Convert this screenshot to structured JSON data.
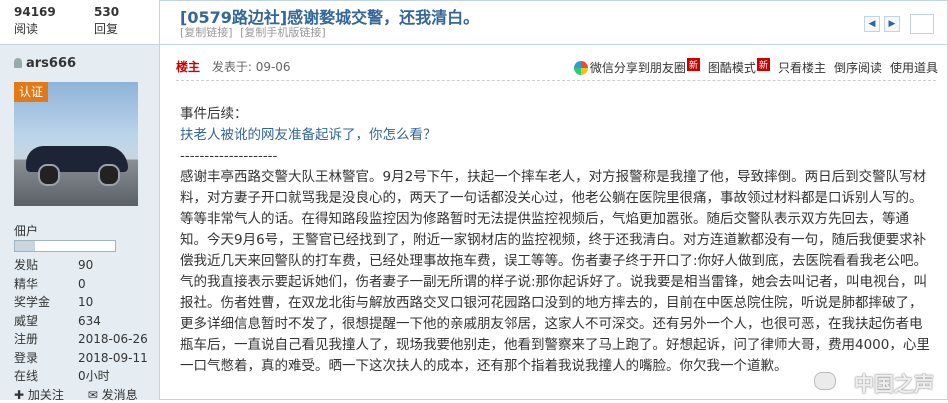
{
  "stats": {
    "views_num": "94169",
    "views_label": "阅读",
    "replies_num": "530",
    "replies_label": "回复"
  },
  "thread": {
    "title": "[0579路边社]感谢婺城交警，还我清白。",
    "copy_link": "[复制链接]",
    "copy_mobile_link": "[复制手机版链接]"
  },
  "author": {
    "name": "ars666",
    "badge": "认证",
    "rank": "佃户",
    "rank_progress": 0.2,
    "fields": [
      {
        "k": "发贴",
        "v": "90"
      },
      {
        "k": "精华",
        "v": "0"
      },
      {
        "k": "奖学金",
        "v": "10"
      },
      {
        "k": "威望",
        "v": "634"
      },
      {
        "k": "注册",
        "v": "2018-06-26"
      },
      {
        "k": "登录",
        "v": "2018-09-11"
      },
      {
        "k": "在线",
        "v": "0小时"
      }
    ],
    "follow": "加关注",
    "message": "发消息"
  },
  "post": {
    "floor": "楼主",
    "posted_at": "发表于: 09-06",
    "actions": {
      "wechat_share": "微信分享到朋友圈",
      "image_mode": "图酷模式",
      "new_badge": "新",
      "only_author": "只看楼主",
      "reverse_read": "倒序阅读",
      "use_tool": "使用道具"
    },
    "lines": [
      "事件后续：",
      "扶老人被讹的网友准备起诉了，你怎么看？",
      "--------------------",
      "感谢丰亭西路交警大队王林警官。9月2号下午，扶起一个摔车老人，对方报警称是我撞了他，导致摔倒。两日后到交警队写材料，对方妻子开口就骂我是没良心的，两天了一句话都没关心过，他老公躺在医院里很痛，事故领过材料都是口诉别人写的。等等非常气人的话。在得知路段监控因为修路暂时无法提供监控视频后，气焰更加嚣张。随后交警队表示双方先回去，等通知。今天9月6号，王警官已经找到了，附近一家钢材店的监控视频，终于还我清白。对方连道歉都没有一句，随后我便要求补偿我近几天来回警队的打车费，已经处理事故拖车费，误工等等。伤者妻子终于开口了:你好人做到底，去医院看看我老公吧。气的我直接表示要起诉她们，伤者妻子一副无所谓的样子说:那你起诉好了。说我要是相当雷锋，她会去叫记者，叫电视台，叫报社。伤者姓曹，在双龙北街与解放西路交叉口银河花园路口没到的地方摔去的，目前在中医总院住院，听说是肺都摔破了，更多详细信息暂时不发了，很想提醒一下他的亲戚朋友邻居，这家人不可深交。还有另外一个人，也很可恶，在我扶起伤者电瓶车后，一直说自己看见我撞人了，现场我要他别走，他看到警察来了马上跑了。好想起诉，问了律师大哥，费用4000，心里一口气憋着，真的难受。晒一下这次扶人的成本，还有那个指着我说我撞人的嘴脸。你欠我一个道歉。"
    ]
  },
  "watermark": "中国之声"
}
